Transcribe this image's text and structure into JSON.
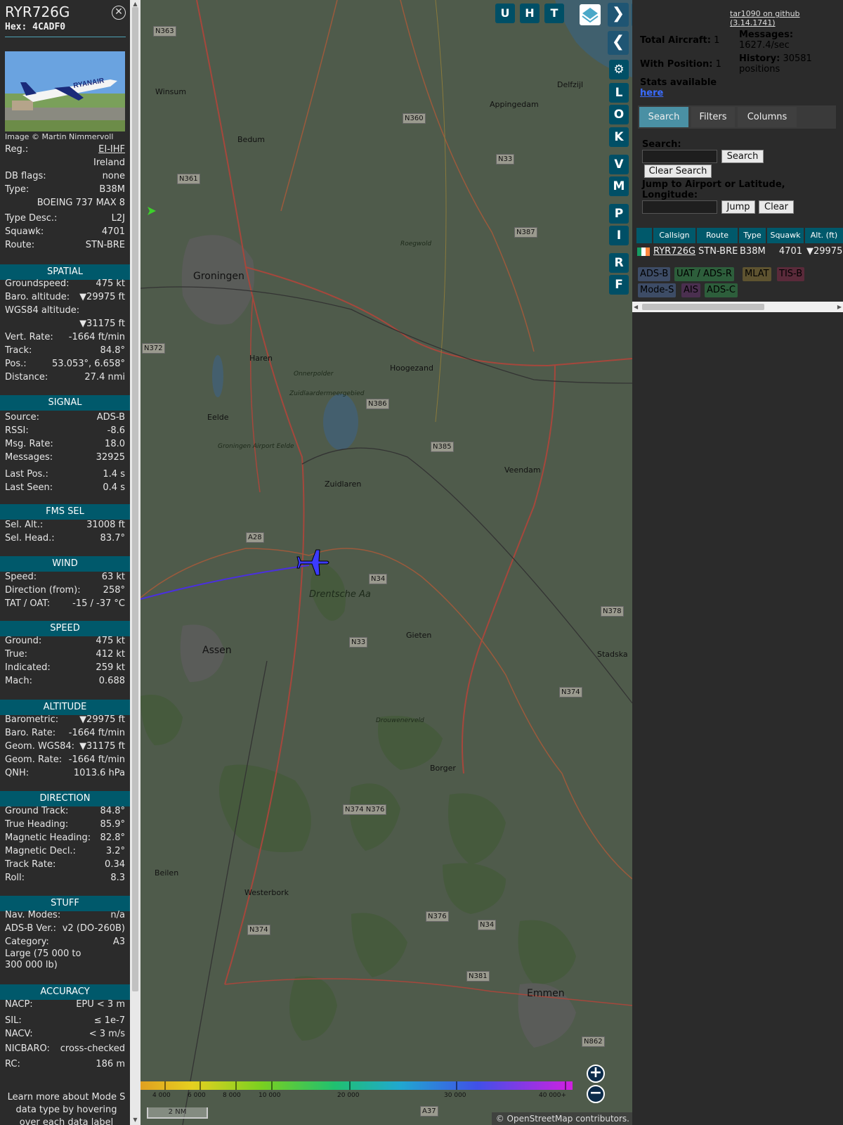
{
  "aircraft": {
    "callsign": "RYR726G",
    "hex": "Hex: 4CADF0",
    "image_caption": "Image © Martin Nimmervoll"
  },
  "info_rows": [
    {
      "label": "Reg.:",
      "value": "EI-IHF"
    },
    {
      "label": "",
      "value": "Ireland"
    },
    {
      "label": "DB flags:",
      "value": "none"
    },
    {
      "label": "Type:",
      "value": "B38M"
    },
    {
      "label": "",
      "value": "BOEING 737 MAX 8"
    },
    {
      "label": "Type Desc.:",
      "value": "L2J"
    },
    {
      "label": "Squawk:",
      "value": "4701"
    },
    {
      "label": "Route:",
      "value": "STN-BRE"
    }
  ],
  "sections": {
    "spatial": "SPATIAL",
    "signal": "SIGNAL",
    "fms_sel": "FMS SEL",
    "wind": "WIND",
    "speed": "SPEED",
    "altitude": "ALTITUDE",
    "direction": "DIRECTION",
    "stuff": "STUFF",
    "accuracy": "ACCURACY"
  },
  "spatial": [
    {
      "label": "Groundspeed:",
      "value": "475 kt"
    },
    {
      "label": "Baro. altitude:",
      "value": "▼29975 ft"
    },
    {
      "label": "WGS84 altitude:",
      "value": ""
    },
    {
      "label": "",
      "value": "▼31175 ft"
    },
    {
      "label": "Vert. Rate:",
      "value": "-1664 ft/min"
    },
    {
      "label": "Track:",
      "value": "84.8°"
    },
    {
      "label": "Pos.:",
      "value": "53.053°, 6.658°"
    },
    {
      "label": "Distance:",
      "value": "27.4 nmi"
    }
  ],
  "signal": [
    {
      "label": "Source:",
      "value": "ADS-B"
    },
    {
      "label": "RSSI:",
      "value": "-8.6"
    },
    {
      "label": "Msg. Rate:",
      "value": "18.0"
    },
    {
      "label": "Messages:",
      "value": "32925"
    },
    {
      "label": "Last Pos.:",
      "value": "1.4 s"
    },
    {
      "label": "Last Seen:",
      "value": "0.4 s"
    }
  ],
  "fms_sel": [
    {
      "label": "Sel. Alt.:",
      "value": "31008 ft"
    },
    {
      "label": "Sel. Head.:",
      "value": "83.7°"
    }
  ],
  "wind": [
    {
      "label": "Speed:",
      "value": "63 kt"
    },
    {
      "label": "Direction (from):",
      "value": "258°"
    },
    {
      "label": "TAT / OAT:",
      "value": "-15 / -37 °C"
    }
  ],
  "speed": [
    {
      "label": "Ground:",
      "value": "475 kt"
    },
    {
      "label": "True:",
      "value": "412 kt"
    },
    {
      "label": "Indicated:",
      "value": "259 kt"
    },
    {
      "label": "Mach:",
      "value": "0.688"
    }
  ],
  "altitude": [
    {
      "label": "Barometric:",
      "value": "▼29975 ft"
    },
    {
      "label": "Baro. Rate:",
      "value": "-1664 ft/min"
    },
    {
      "label": "Geom. WGS84:",
      "value": "▼31175 ft"
    },
    {
      "label": "Geom. Rate:",
      "value": "-1664 ft/min"
    },
    {
      "label": "QNH:",
      "value": "1013.6 hPa"
    }
  ],
  "direction": [
    {
      "label": "Ground Track:",
      "value": "84.8°"
    },
    {
      "label": "True Heading:",
      "value": "85.9°"
    },
    {
      "label": "Magnetic Heading:",
      "value": "82.8°"
    },
    {
      "label": "Magnetic Decl.:",
      "value": "3.2°"
    },
    {
      "label": "Track Rate:",
      "value": "0.34"
    },
    {
      "label": "Roll:",
      "value": "8.3"
    }
  ],
  "stuff": [
    {
      "label": "Nav. Modes:",
      "value": "n/a"
    },
    {
      "label": "ADS-B Ver.:",
      "value": "v2 (DO-260B)"
    },
    {
      "label": "Category:",
      "value": "A3"
    },
    {
      "label": "Large (75 000 to",
      "value": ""
    },
    {
      "label": "300 000 lb)",
      "value": ""
    }
  ],
  "accuracy": [
    {
      "label": "NACP:",
      "value": "EPU < 3 m"
    },
    {
      "label": "SIL:",
      "value": "≤ 1e-7"
    },
    {
      "label": "NACV:",
      "value": "< 3 m/s"
    },
    {
      "label": "NICBARO:",
      "value": "cross-checked"
    },
    {
      "label": "RC:",
      "value": "186 m"
    }
  ],
  "footer_note": "Learn more about Mode S data type by hovering over each data label",
  "map": {
    "top_buttons": [
      "U",
      "H",
      "T"
    ],
    "side_buttons": [
      "L",
      "O",
      "K",
      "V",
      "M",
      "P",
      "I",
      "R",
      "F"
    ],
    "places": [
      "Winsum",
      "Bedum",
      "Appingedam",
      "Delfzijl",
      "Groningen",
      "Haren",
      "Hoogezand",
      "Eelde",
      "Zuidlaren",
      "Veendam",
      "Assen",
      "Gieten",
      "Drentsche Aa",
      "Borger",
      "Beilen",
      "Westerbork",
      "Emmen",
      "Stadska",
      "Onnerpolder",
      "Zuidlaardermeergebied",
      "Drouwenerveld",
      "Roegwold",
      "Groningen Airport Eelde"
    ],
    "roads": [
      "N363",
      "N361",
      "N360",
      "N33",
      "N387",
      "N372",
      "N386",
      "N385",
      "A28",
      "N34",
      "N33",
      "N374",
      "N378",
      "N376",
      "N374",
      "N381",
      "N862",
      "A37",
      "N34",
      "N374 N376"
    ],
    "altitude_scale": [
      "4 000",
      "6 000",
      "8 000",
      "10 000",
      "20 000",
      "30 000",
      "40 000+"
    ],
    "scale_label": "2 NM",
    "attribution_prefix": "© ",
    "attribution_link": "OpenStreetMap",
    "attribution_suffix": " contributors."
  },
  "right": {
    "github_link": "tar1090 on github (3.14.1741)",
    "total_aircraft_label": "Total Aircraft:",
    "total_aircraft": "1",
    "with_position_label": "With Position:",
    "with_position": "1",
    "messages_label": "Messages:",
    "messages_rate": "1627.4/sec",
    "history_label": "History:",
    "history_value": "30581",
    "history_unit": "positions",
    "stats_label": "Stats available",
    "stats_link": "here",
    "tabs": [
      "Search",
      "Filters",
      "Columns"
    ],
    "search_label": "Search:",
    "search_button": "Search",
    "clear_search_button": "Clear Search",
    "jump_label": "Jump to Airport or Latitude, Longitude:",
    "jump_button": "Jump",
    "clear_button": "Clear",
    "table_headers": [
      "Callsign",
      "Route",
      "Type",
      "Squawk",
      "Alt. (ft)"
    ],
    "table_row": {
      "callsign": "RYR726G",
      "route": "STN-BRE",
      "type": "B38M",
      "squawk": "4701",
      "alt": "▼29975"
    },
    "source_badges": [
      "ADS-B",
      "UAT / ADS-R",
      "MLAT",
      "TIS-B",
      "Mode-S",
      "AIS",
      "ADS-C"
    ]
  }
}
